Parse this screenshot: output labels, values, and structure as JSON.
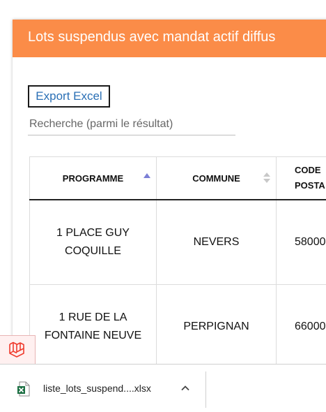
{
  "panel": {
    "title": "Lots suspendus avec mandat actif diffus",
    "header_color": "#fb8c48"
  },
  "toolbar": {
    "export_label": "Export Excel"
  },
  "search": {
    "placeholder": "Recherche (parmi le résultat)",
    "value": ""
  },
  "table": {
    "columns": [
      {
        "label": "PROGRAMME",
        "sort": "ascending"
      },
      {
        "label": "COMMUNE",
        "sort": "none"
      },
      {
        "label": "CODE POSTA",
        "sort": "none"
      }
    ],
    "rows": [
      {
        "programme": "1 PLACE GUY COQUILLE",
        "commune": "NEVERS",
        "code_postal": "58000"
      },
      {
        "programme": "1 RUE DE LA FONTAINE NEUVE",
        "commune": "PERPIGNAN",
        "code_postal": "66000"
      }
    ]
  },
  "download_bar": {
    "file_name": "liste_lots_suspend....xlsx",
    "file_icon": "excel-file-icon",
    "menu_icon": "chevron-up-icon"
  },
  "badge": {
    "icon": "laravel-icon",
    "accent": "#ef3b2d"
  }
}
